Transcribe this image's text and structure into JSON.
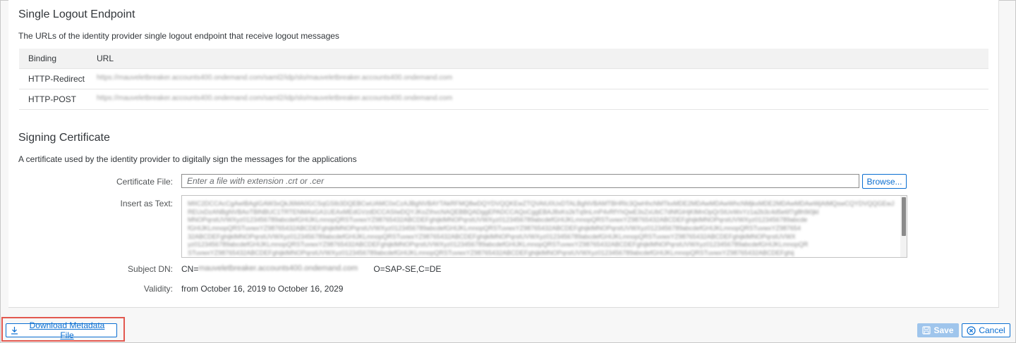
{
  "slo": {
    "title": "Single Logout Endpoint",
    "description": "The URLs of the identity provider single logout endpoint that receive logout messages",
    "columns": {
      "binding": "Binding",
      "url": "URL"
    },
    "rows": [
      {
        "binding": "HTTP-Redirect",
        "url": "https://mauveletbreaker.accounts400.ondemand.com/saml2/idp/slo/mauveletbreaker.accounts400.ondemand.com"
      },
      {
        "binding": "HTTP-POST",
        "url": "https://mauveletbreaker.accounts400.ondemand.com/saml2/idp/slo/mauveletbreaker.accounts400.ondemand.com"
      }
    ]
  },
  "signing": {
    "title": "Signing Certificate",
    "description": "A certificate used by the identity provider to digitally sign the messages for the applications",
    "file_label": "Certificate File:",
    "file_placeholder": "Enter a file with extension .crt or .cer",
    "browse_label": "Browse...",
    "insert_label": "Insert as Text:",
    "cert_lines": [
      "MIIC2DCCAcCgAwIBAgIGAW3xQkJ6MA0GCSqGSIb3DQEBCwUAMC0xCzAJBgNVBAYTAkRFMQ8wDQYDVQQKEwZTQVAtU0UxDTALBgNVBAMTBHRlc3QwHhcNMTkxMDE2MDAwMDAwWhcNMjkxMDE2MDAwMDAwWjAtMQswCQYDVQQGEwJ",
      "REUxDzANBgNVBAoTBlNBUC1TRTENMAsGA1UEAxMEdGVzdDCCASIwDQYJKoZIhvcNAQEBBQADggEPADCCAQoCggEBAJ8xKs2kTq9nLmP4vRfYhQwE3sZxUbC7dNfGiHjKlMnOpQrStUvWxYz1a2b3c4d5e6f7g8h9i0jkl",
      "MNOPqrstUVWXyz0123456789abcdefGHIJKLmnopQRSTuvwxYZ98765432ABCDEFghijklMNOPqrstUVWXyz0123456789abcdefGHIJKLmnopQRSTuvwxYZ98765432ABCDEFghijklMNOPqrstUVWXyz0123456789abcde",
      "fGHIJKLmnopQRSTuvwxYZ98765432ABCDEFghijklMNOPqrstUVWXyz0123456789abcdefGHIJKLmnopQRSTuvwxYZ98765432ABCDEFghijklMNOPqrstUVWXyz0123456789abcdefGHIJKLmnopQRSTuvwxYZ987654",
      "32ABCDEFghijklMNOPqrstUVWXyz0123456789abcdefGHIJKLmnopQRSTuvwxYZ98765432ABCDEFghijklMNOPqrstUVWXyz0123456789abcdefGHIJKLmnopQRSTuvwxYZ98765432ABCDEFghijklMNOPqrstUVWX",
      "yz0123456789abcdefGHIJKLmnopQRSTuvwxYZ98765432ABCDEFghijklMNOPqrstUVWXyz0123456789abcdefGHIJKLmnopQRSTuvwxYZ98765432ABCDEFghijklMNOPqrstUVWXyz0123456789abcdefGHIJKLmnopQR",
      "STuvwxYZ98765432ABCDEFghijklMNOPqrstUVWXyz0123456789abcdefGHIJKLmnopQRSTuvwxYZ98765432ABCDEFghijklMNOPqrstUVWXyz0123456789abcdefGHIJKLmnopQRSTuvwxYZ98765432ABCDEFghij"
    ],
    "subject_label": "Subject DN:",
    "subject_prefix": "CN=",
    "subject_hidden": "mauveletbreaker.accounts400.ondemand.com",
    "subject_suffix": "O=SAP-SE,C=DE",
    "validity_label": "Validity:",
    "validity_value": "from October 16, 2019 to October 16, 2029"
  },
  "footer": {
    "download_label": "Download Metadata File",
    "save_label": "Save",
    "cancel_label": "Cancel"
  },
  "icons": {
    "download": "download-icon",
    "save": "save-icon",
    "cancel": "cancel-circle-icon"
  },
  "colors": {
    "accent": "#0a6ed1",
    "save_disabled_bg": "#9fc5ec",
    "highlight": "#e2584f"
  }
}
